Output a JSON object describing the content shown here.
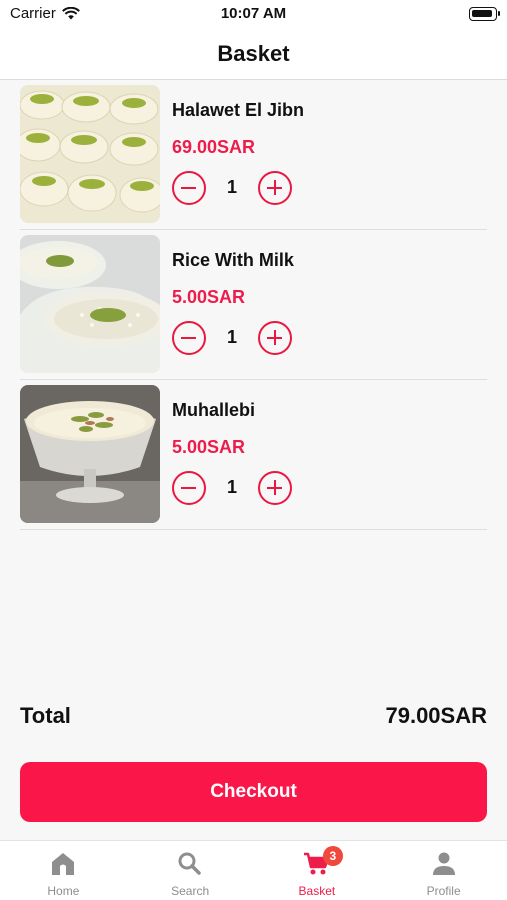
{
  "status_bar": {
    "carrier": "Carrier",
    "time": "10:07 AM"
  },
  "header": {
    "title": "Basket"
  },
  "basket": {
    "items": [
      {
        "name": "Halawet El Jibn",
        "price": "69.00SAR",
        "quantity": "1",
        "image": "halawet-el-jibn-photo"
      },
      {
        "name": "Rice With Milk",
        "price": "5.00SAR",
        "quantity": "1",
        "image": "rice-with-milk-photo"
      },
      {
        "name": "Muhallebi",
        "price": "5.00SAR",
        "quantity": "1",
        "image": "muhallebi-photo"
      }
    ]
  },
  "summary": {
    "total_label": "Total",
    "total_value": "79.00SAR"
  },
  "checkout": {
    "label": "Checkout"
  },
  "tab_bar": {
    "tabs": [
      {
        "label": "Home",
        "icon": "home-icon",
        "active": false
      },
      {
        "label": "Search",
        "icon": "search-icon",
        "active": false
      },
      {
        "label": "Basket",
        "icon": "cart-icon",
        "active": true,
        "badge": "3"
      },
      {
        "label": "Profile",
        "icon": "person-icon",
        "active": false
      }
    ]
  },
  "colors": {
    "accent": "#ee1c4a",
    "checkout_bg": "#fb1649",
    "badge": "#f0483c",
    "background": "#f7f7f7",
    "inactive_tab": "#8e8e8e"
  }
}
